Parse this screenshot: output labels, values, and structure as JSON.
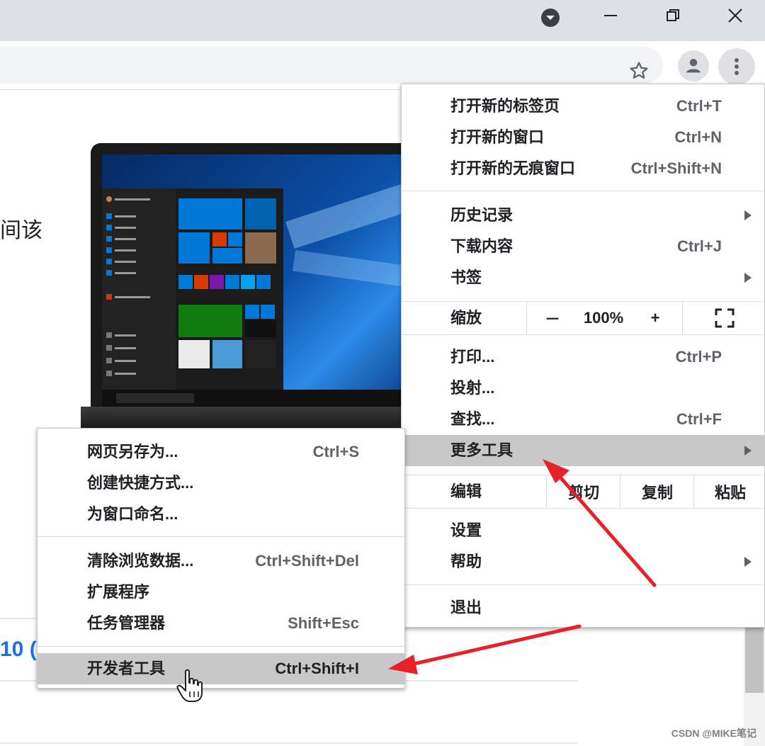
{
  "browser": {
    "window_controls": [
      "minimize-icon",
      "restore-icon",
      "close-icon"
    ],
    "tab_search_icon": "chevron-down-circle-icon",
    "omnibox_icons": [
      "star-icon"
    ],
    "toolbar_icons": [
      "profile-icon",
      "kebab-menu-icon"
    ]
  },
  "page": {
    "fragment_text": "间该",
    "link_text": "10 (",
    "laptop_image": "windows-10-laptop-image"
  },
  "menu": {
    "group1": [
      {
        "label": "打开新的标签页",
        "shortcut": "Ctrl+T"
      },
      {
        "label": "打开新的窗口",
        "shortcut": "Ctrl+N"
      },
      {
        "label": "打开新的无痕窗口",
        "shortcut": "Ctrl+Shift+N"
      }
    ],
    "group2": [
      {
        "label": "历史记录",
        "shortcut": ""
      },
      {
        "label": "下载内容",
        "shortcut": "Ctrl+J"
      },
      {
        "label": "书签",
        "shortcut": ""
      }
    ],
    "zoom": {
      "label": "缩放",
      "minus": "－",
      "value": "100%",
      "plus": "+"
    },
    "group3": [
      {
        "label": "打印...",
        "shortcut": "Ctrl+P"
      },
      {
        "label": "投射...",
        "shortcut": ""
      },
      {
        "label": "查找...",
        "shortcut": "Ctrl+F"
      },
      {
        "label": "更多工具",
        "shortcut": ""
      }
    ],
    "edit": {
      "label": "编辑",
      "cut": "剪切",
      "copy": "复制",
      "paste": "粘贴"
    },
    "group4": [
      {
        "label": "设置",
        "shortcut": ""
      },
      {
        "label": "帮助",
        "shortcut": ""
      }
    ],
    "exit": {
      "label": "退出"
    }
  },
  "submenu": {
    "group1": [
      {
        "label": "网页另存为...",
        "shortcut": "Ctrl+S"
      },
      {
        "label": "创建快捷方式...",
        "shortcut": ""
      },
      {
        "label": "为窗口命名...",
        "shortcut": ""
      }
    ],
    "group2": [
      {
        "label": "清除浏览数据...",
        "shortcut": "Ctrl+Shift+Del"
      },
      {
        "label": "扩展程序",
        "shortcut": ""
      },
      {
        "label": "任务管理器",
        "shortcut": "Shift+Esc"
      }
    ],
    "devtools": {
      "label": "开发者工具",
      "shortcut": "Ctrl+Shift+I"
    }
  },
  "annotations": {
    "arrow_color": "#e8202a"
  },
  "watermark": "CSDN @MIKE笔记"
}
